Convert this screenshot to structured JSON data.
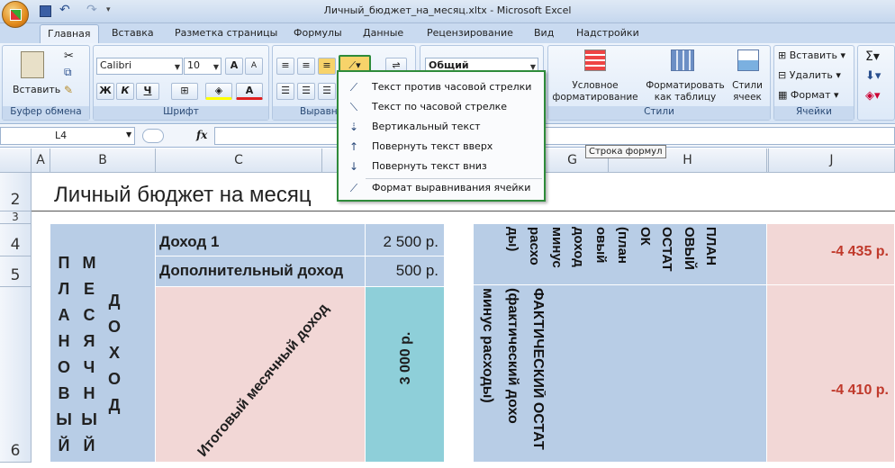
{
  "window": {
    "title": "Личный_бюджет_на_месяц.xltx - Microsoft Excel"
  },
  "tabs": [
    "Главная",
    "Вставка",
    "Разметка страницы",
    "Формулы",
    "Данные",
    "Рецензирование",
    "Вид",
    "Надстройки"
  ],
  "ribbon": {
    "paste": "Вставить",
    "clipboard": "Буфер обмена",
    "font_name": "Calibri",
    "font_size": "10",
    "font_group": "Шрифт",
    "bold": "Ж",
    "italic": "К",
    "underline": "Ч",
    "align_group": "Выравн",
    "number_format": "Общий",
    "cond_format": "Условное\nформатирование",
    "format_table": "Форматировать\nкак таблицу",
    "cell_styles": "Стили\nячеек",
    "styles_group": "Стили",
    "insert": "Вставить",
    "delete": "Удалить",
    "format": "Формат",
    "cells_group": "Ячейки"
  },
  "formula_bar": {
    "name_box": "L4",
    "fx": "fx",
    "tooltip": "Строка формул"
  },
  "orientation_menu": [
    {
      "icon": "ccw-text-icon",
      "label": "Текст против часовой стрелки"
    },
    {
      "icon": "cw-text-icon",
      "label": "Текст по часовой стрелке"
    },
    {
      "icon": "vertical-text-icon",
      "label": "Вертикальный текст"
    },
    {
      "icon": "rotate-up-icon",
      "label": "Повернуть текст вверх"
    },
    {
      "icon": "rotate-down-icon",
      "label": "Повернуть текст вниз"
    },
    {
      "icon": "format-align-icon",
      "label": "Формат выравнивания ячейки"
    }
  ],
  "columns": [
    "A",
    "B",
    "C",
    "",
    "",
    "G",
    "H",
    "",
    "J"
  ],
  "rows": [
    "2",
    "3",
    "4",
    "5",
    "6"
  ],
  "sheet": {
    "title": "Личный бюджет на месяц",
    "planned_left": "ПЛАНОВЫЙ",
    "planned_mid": "МЕСЯЧНЫЙ",
    "planned_right": "ДОХОД",
    "income1_label": "Доход 1",
    "income1_value": "2 500 р.",
    "extra_label": "Дополнительный доход",
    "extra_value": "500 р.",
    "total_label": "Итоговый месячный доход",
    "total_value": "3 000 р.",
    "plan_lines": [
      "ПЛАН",
      "ОВЫЙ",
      "ОСТАТ",
      "ОК",
      "(план",
      "овый",
      "доход",
      "минус",
      "расхо",
      "ды)"
    ],
    "fact_lines": [
      "ФАКТИЧЕСКИЙ ОСТАТ",
      "(фактический дохо",
      "минус расходы)"
    ],
    "value_plan": "-4 435 р.",
    "value_fact": "-4 410 р."
  }
}
